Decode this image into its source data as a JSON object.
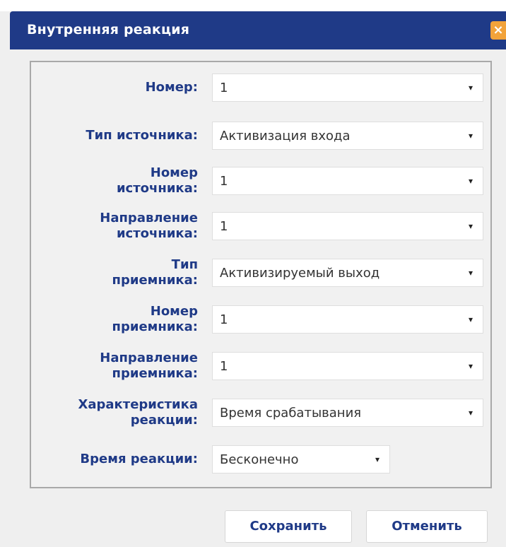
{
  "dialog": {
    "title": "Внутренняя реакция",
    "close_label": "×"
  },
  "form": {
    "rows": [
      {
        "label": "Номер:",
        "value": "1"
      },
      {
        "label": "Тип источника:",
        "value": "Активизация входа"
      },
      {
        "label": "Номер\nисточника:",
        "value": "1"
      },
      {
        "label": "Направление\nисточника:",
        "value": "1"
      },
      {
        "label": "Тип\nприемника:",
        "value": "Активизируемый выход"
      },
      {
        "label": "Номер\nприемника:",
        "value": "1"
      },
      {
        "label": "Направление\nприемника:",
        "value": "1"
      },
      {
        "label": "Характеристика\nреакции:",
        "value": "Время срабатывания"
      },
      {
        "label": "Время реакции:",
        "value": "Бесконечно"
      }
    ],
    "arrow_glyph": "▾"
  },
  "buttons": {
    "save": "Сохранить",
    "cancel": "Отменить"
  },
  "colors": {
    "title_bar": "#1f3a87",
    "label_text": "#1f3a87",
    "close_button": "#f2a33b"
  }
}
